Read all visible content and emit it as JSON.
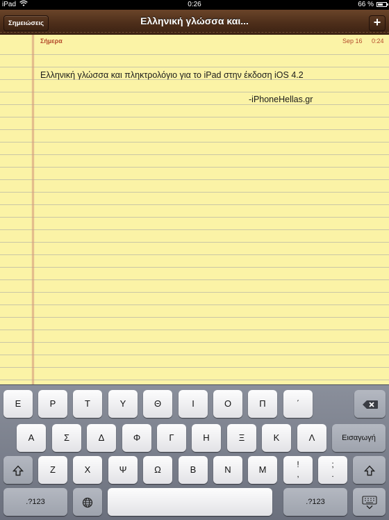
{
  "status_bar": {
    "carrier": "iPad",
    "time": "0:26",
    "battery_percent": "66 %",
    "battery_level": 0.66
  },
  "nav": {
    "back_label": "Σημειώσεις",
    "title": "Ελληνική γλώσσα και...",
    "add_label": "+"
  },
  "note": {
    "day": "Σήμερα",
    "date": "Sep 16",
    "time": "0:24",
    "lines": [
      "Ελληνική γλώσσα και πληκτρολόγιο για το iPad στην έκδοση iOS 4.2",
      "-iPhoneHellas.gr"
    ]
  },
  "keyboard": {
    "row1": [
      "Ε",
      "Ρ",
      "Τ",
      "Υ",
      "Θ",
      "Ι",
      "Ο",
      "Π",
      "΄"
    ],
    "row2": [
      "Α",
      "Σ",
      "Δ",
      "Φ",
      "Γ",
      "Η",
      "Ξ",
      "Κ",
      "Λ"
    ],
    "row3": [
      "Ζ",
      "Χ",
      "Ψ",
      "Ω",
      "Β",
      "Ν",
      "Μ"
    ],
    "enter_label": "Εισαγωγή",
    "numbers_label": ".?123",
    "punct1": [
      "!",
      ","
    ],
    "punct2": [
      ";",
      "."
    ],
    "icons": [
      "backspace-icon",
      "shift-icon",
      "globe-icon",
      "hide-keyboard-icon",
      "wifi-icon"
    ]
  }
}
